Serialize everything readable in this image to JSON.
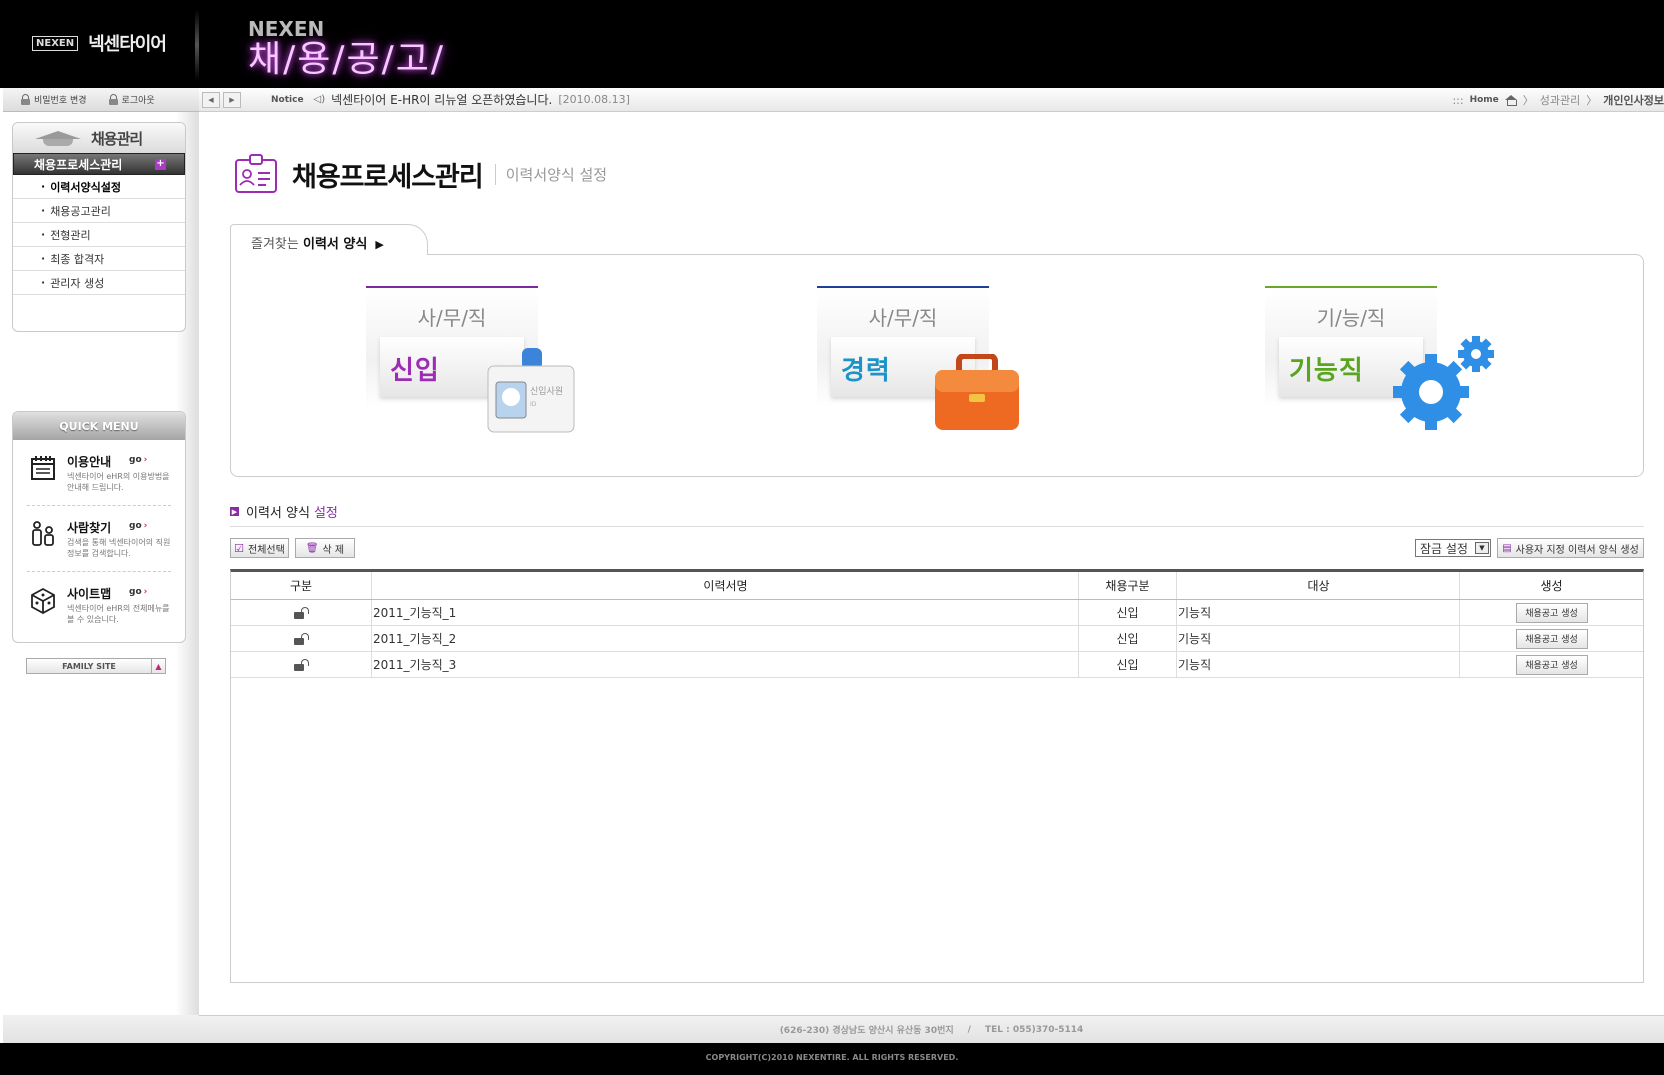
{
  "header": {
    "brand_logo": "NEXEN",
    "brand_name": "넥센타이어",
    "hero_sub": "NEXEN",
    "hero_title": "채/용/공/고/"
  },
  "util": {
    "password_change": "비밀번호 변경",
    "logout": "로그아웃"
  },
  "sidebar": {
    "menu_title": "채용관리",
    "active_group": "채용프로세스관리",
    "items": [
      {
        "label": "이력서양식설정"
      },
      {
        "label": "채용공고관리"
      },
      {
        "label": "전형관리"
      },
      {
        "label": "최종 합격자"
      },
      {
        "label": "관리자 생성"
      }
    ]
  },
  "quick": {
    "title": "QUICK MENU",
    "items": [
      {
        "title": "이용안내",
        "go": "go",
        "desc": "넥센타이어 eHR의 이용방법을 안내해 드립니다.",
        "icon": "calendar-icon"
      },
      {
        "title": "사람찾기",
        "go": "go",
        "desc": "검색을 통해 넥센타이어의 직원정보를 검색합니다.",
        "icon": "people-icon"
      },
      {
        "title": "사이트맵",
        "go": "go",
        "desc": "넥센타이어 eHR의 전체메뉴를 볼 수 있습니다.",
        "icon": "cube-icon"
      }
    ],
    "family_site": "FAMILY SITE"
  },
  "notice": {
    "label": "Notice",
    "text": "넥센타이어 E-HR이 리뉴얼 오픈하였습니다.",
    "date": "[2010.08.13]"
  },
  "breadcrumb": {
    "home": "Home",
    "level1": "성과관리",
    "current": "개인인사정보"
  },
  "page": {
    "title": "채용프로세스관리",
    "subtitle": "이력서양식 설정"
  },
  "favorites": {
    "tab_prefix": "즐겨찾는 ",
    "tab_bold": "이력서 양식",
    "cards": [
      {
        "category": "사/무/직",
        "label": "신입",
        "color": "#9d2cb5",
        "line": "#7a2a9a",
        "art_text": "신입사원",
        "art_sub": "ID"
      },
      {
        "category": "사/무/직",
        "label": "경력",
        "color": "#1d93c8",
        "line": "#1f3f9a"
      },
      {
        "category": "기/능/직",
        "label": "기능직",
        "color": "#5aa520",
        "line": "#6aa82a"
      }
    ]
  },
  "section": {
    "title_prefix": "이력서 양식",
    "title_accent": "설정",
    "select_all": "전체선택",
    "delete": "삭 제",
    "lock_select": "잠금 설정",
    "custom_create": "사용자 지정 이력서 양식 생성"
  },
  "table": {
    "headers": [
      "구분",
      "이력서명",
      "채용구분",
      "대상",
      "생성"
    ],
    "rows": [
      {
        "name": "2011_기능직_1",
        "type": "신입",
        "target": "기능직",
        "action": "채용공고 생성"
      },
      {
        "name": "2011_기능직_2",
        "type": "신입",
        "target": "기능직",
        "action": "채용공고 생성"
      },
      {
        "name": "2011_기능직_3",
        "type": "신입",
        "target": "기능직",
        "action": "채용공고 생성"
      }
    ]
  },
  "footer": {
    "address": "(626-230) 경상남도 양산시 유산동 30번지",
    "sep": "/",
    "tel": "TEL : 055)370-5114",
    "copyright": "COPYRIGHT(C)2010 NEXENTIRE. ALL RIGHTS RESERVED."
  }
}
